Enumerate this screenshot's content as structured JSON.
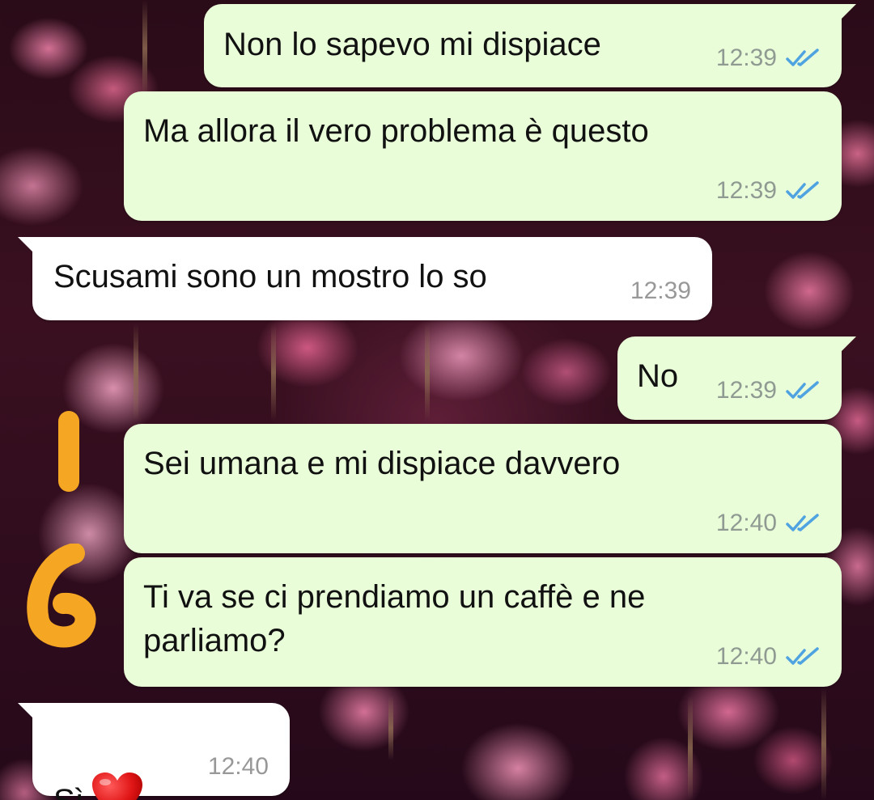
{
  "colors": {
    "outgoing_bubble": "#e9fdd9",
    "incoming_bubble": "#ffffff",
    "read_ticks": "#4fa3e0",
    "timestamp": "#8f9a92",
    "scribble": "#f5a623"
  },
  "background": {
    "description_icon": "cherry-blossom-wallpaper"
  },
  "messages": [
    {
      "direction": "outgoing",
      "text": "Non lo sapevo mi dispiace",
      "time": "12:39",
      "status_icon": "double-check-read-icon"
    },
    {
      "direction": "outgoing",
      "text": "Ma allora il vero problema è questo",
      "time": "12:39",
      "status_icon": "double-check-read-icon"
    },
    {
      "direction": "incoming",
      "text": "Scusami sono un mostro lo so",
      "time": "12:39"
    },
    {
      "direction": "outgoing",
      "text": "No",
      "time": "12:39",
      "status_icon": "double-check-read-icon"
    },
    {
      "direction": "outgoing",
      "text": "Sei umana e mi dispiace davvero",
      "time": "12:40",
      "status_icon": "double-check-read-icon"
    },
    {
      "direction": "outgoing",
      "text": "Ti va se ci prendiamo un caffè e ne\nparliamo?",
      "time": "12:40",
      "status_icon": "double-check-read-icon"
    },
    {
      "direction": "incoming",
      "text": "Sì",
      "emoji_icon": "red-heart-emoji",
      "time": "12:40"
    }
  ]
}
